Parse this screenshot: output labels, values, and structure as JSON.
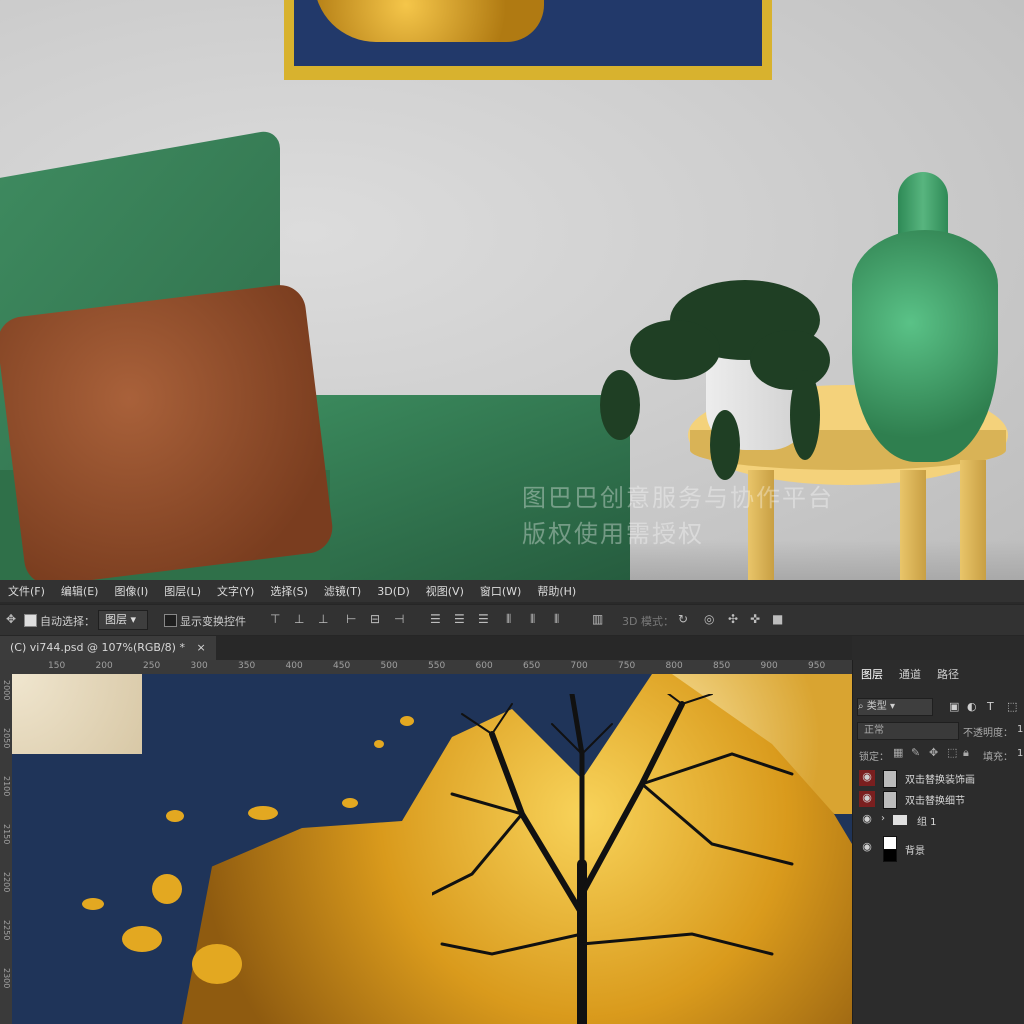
{
  "room": {
    "watermark_line1": "图巴巴创意服务与协作平台",
    "watermark_line2": "版权使用需授权"
  },
  "menu": [
    "文件(F)",
    "编辑(E)",
    "图像(I)",
    "图层(L)",
    "文字(Y)",
    "选择(S)",
    "滤镜(T)",
    "3D(D)",
    "视图(V)",
    "窗口(W)",
    "帮助(H)"
  ],
  "options": {
    "auto_select_label": "自动选择：",
    "auto_select_checked": true,
    "auto_select_target": "图层",
    "show_transform_label": "显示变换控件",
    "show_transform_checked": false,
    "mode_3d_label": "3D 模式："
  },
  "document": {
    "tab_title": "(C) vi744.psd @ 107%(RGB/8) *",
    "close_glyph": "×",
    "ruler_top": [
      "150",
      "200",
      "250",
      "300",
      "350",
      "400",
      "450",
      "500",
      "550",
      "600",
      "650",
      "700",
      "750",
      "800",
      "850",
      "900",
      "950"
    ],
    "ruler_left": [
      "2000",
      "2050",
      "2100",
      "2150",
      "2200",
      "2250",
      "2300"
    ]
  },
  "layers_panel": {
    "tabs": [
      "图层",
      "通道",
      "路径"
    ],
    "filter_kind": "类型",
    "blend_mode": "正常",
    "opacity_label": "不透明度：",
    "opacity_value": "1",
    "lock_label": "锁定：",
    "fill_label": "填充：",
    "fill_value": "1",
    "layers": [
      {
        "name": "双击替换装饰画",
        "visible": true,
        "smart": true
      },
      {
        "name": "双击替换细节",
        "visible": true,
        "smart": true
      },
      {
        "name": "组 1",
        "visible": true,
        "group": true
      },
      {
        "name": "背景",
        "visible": true
      }
    ]
  }
}
